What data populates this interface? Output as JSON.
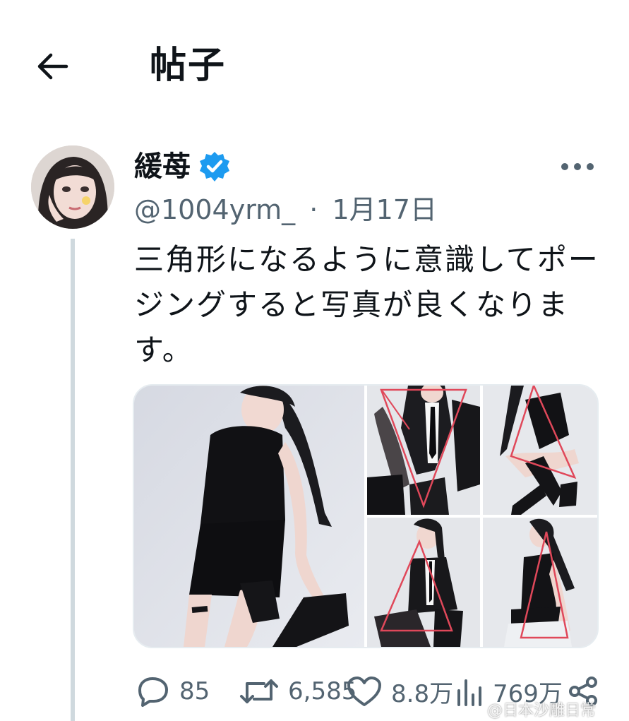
{
  "header": {
    "back_icon": "arrow-left-icon",
    "title": "帖子"
  },
  "post": {
    "author": {
      "display_name": "緩苺",
      "verified": true,
      "verified_color": "#1d9bf0",
      "handle": "@1004yrm_",
      "separator": "·",
      "date": "1月17日"
    },
    "text": "三角形になるように意識してポージングすると写真が良くなります。",
    "more_icon": "more-horizontal-icon",
    "media": {
      "count": 5,
      "layout": "1 large left, 2x2 right",
      "overlay_color": "#e0485a"
    },
    "actions": {
      "replies": "85",
      "retweets": "6,585",
      "likes": "8.8万",
      "views": "769万",
      "reply_icon": "reply-icon",
      "retweet_icon": "retweet-icon",
      "like_icon": "heart-icon",
      "views_icon": "views-chart-icon",
      "share_icon": "share-icon"
    }
  },
  "watermark": {
    "text": "@日本沙雕日常"
  },
  "colors": {
    "text_primary": "#0f1419",
    "text_secondary": "#536471",
    "thread_line": "#cfd9de",
    "accent": "#1d9bf0"
  }
}
